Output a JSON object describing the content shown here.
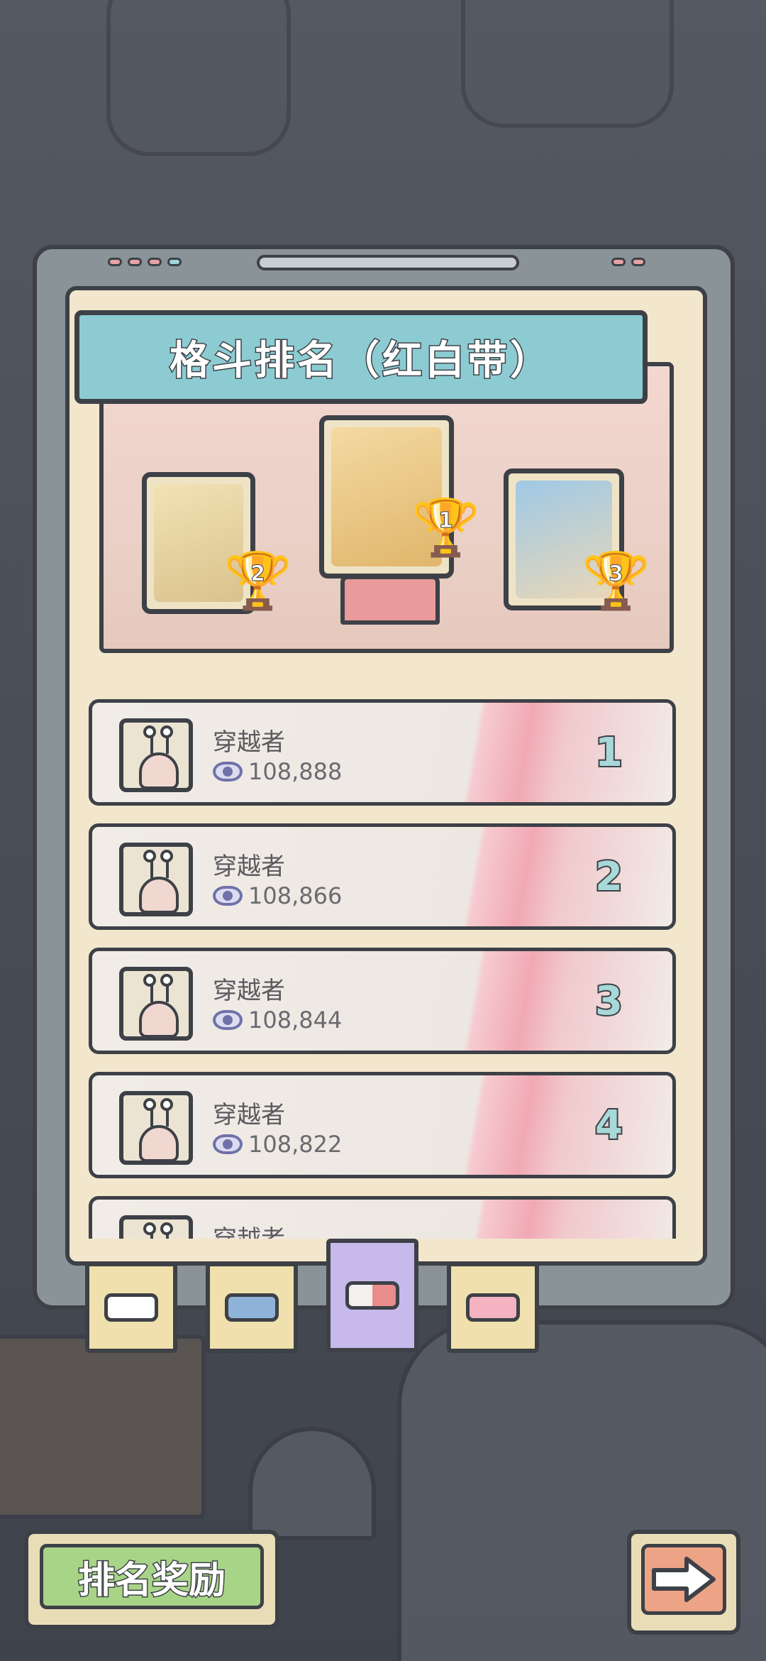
{
  "title": "格斗排名（红白带）",
  "podium": {
    "first": {
      "trophy_number": "1"
    },
    "second": {
      "trophy_number": "2"
    },
    "third": {
      "trophy_number": "3"
    }
  },
  "leaderboard": [
    {
      "name": "穿越者",
      "score": "108,888",
      "rank": "1"
    },
    {
      "name": "穿越者",
      "score": "108,866",
      "rank": "2"
    },
    {
      "name": "穿越者",
      "score": "108,844",
      "rank": "3"
    },
    {
      "name": "穿越者",
      "score": "108,822",
      "rank": "4"
    },
    {
      "name": "穿越者",
      "score": "",
      "rank": ""
    }
  ],
  "tabs": [
    {
      "icon": "white-belt-icon"
    },
    {
      "icon": "blue-belt-icon"
    },
    {
      "icon": "red-white-belt-icon",
      "active": true
    },
    {
      "icon": "pink-belt-icon"
    }
  ],
  "buttons": {
    "reward_label": "排名奖励",
    "next_icon": "arrow-right-icon"
  },
  "colors": {
    "banner": "#8ccbd2",
    "reward_button": "#a8d487",
    "next_button": "#eca386",
    "rank_number": "#a8d8d8",
    "active_tab": "#c7b9ea"
  }
}
